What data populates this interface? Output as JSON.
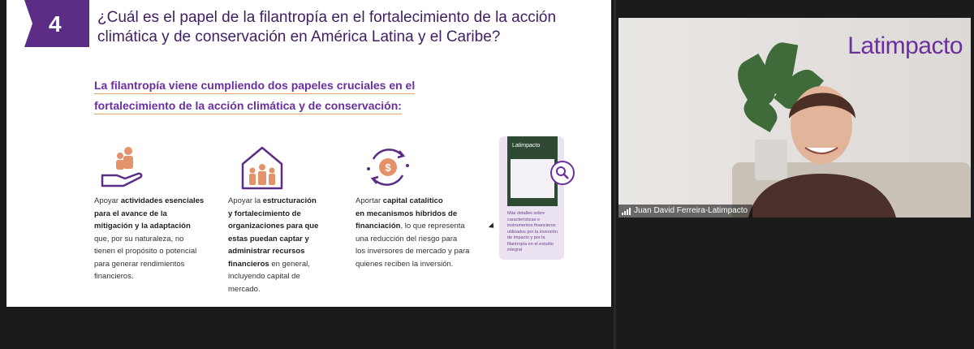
{
  "slide": {
    "number": "4",
    "title_line1": "¿Cuál es el papel de la filantropía en el fortalecimiento de la acción",
    "title_line2": "climática y de conservación en América Latina y el Caribe?",
    "subtitle_line1": "La filantropía viene cumpliendo dos papeles cruciales en el",
    "subtitle_line2": "fortalecimiento de la acción climática y de conservación:",
    "columns": [
      {
        "icon": "hand-people-icon",
        "lines": [
          {
            "pre": "Apoyar ",
            "bold": "actividades esenciales",
            "post": ""
          },
          {
            "pre": "",
            "bold": "para el avance de la",
            "post": ""
          },
          {
            "pre": "",
            "bold": "mitigación y la adaptación",
            "post": ""
          },
          {
            "pre": "que, por su naturaleza, no",
            "bold": "",
            "post": ""
          },
          {
            "pre": "tienen el propósito o potencial",
            "bold": "",
            "post": ""
          },
          {
            "pre": "para generar rendimientos",
            "bold": "",
            "post": ""
          },
          {
            "pre": "financieros.",
            "bold": "",
            "post": ""
          }
        ]
      },
      {
        "icon": "house-people-icon",
        "lines": [
          {
            "pre": "Apoyar la ",
            "bold": "estructuración",
            "post": ""
          },
          {
            "pre": "",
            "bold": "y fortalecimiento de",
            "post": ""
          },
          {
            "pre": "",
            "bold": "organizaciones para que",
            "post": ""
          },
          {
            "pre": "",
            "bold": "estas puedan captar y",
            "post": ""
          },
          {
            "pre": "",
            "bold": "administrar recursos",
            "post": ""
          },
          {
            "pre": "",
            "bold": "financieros",
            "post": " en general,"
          },
          {
            "pre": "incluyendo capital de",
            "bold": "",
            "post": ""
          },
          {
            "pre": "mercado.",
            "bold": "",
            "post": ""
          }
        ]
      },
      {
        "icon": "money-cycle-icon",
        "lines": [
          {
            "pre": "Aportar ",
            "bold": "capital catalítico",
            "post": ""
          },
          {
            "pre": "",
            "bold": "en mecanismos híbridos de",
            "post": ""
          },
          {
            "pre": "",
            "bold": "financiación",
            "post": ", lo que representa"
          },
          {
            "pre": "una reducción del riesgo para",
            "bold": "",
            "post": ""
          },
          {
            "pre": "los inversores de mercado y para",
            "bold": "",
            "post": ""
          },
          {
            "pre": "quienes reciben la inversión.",
            "bold": "",
            "post": ""
          }
        ]
      }
    ],
    "report": {
      "cover_logo": "Latimpacto",
      "text": "Más detalles sobre características e instrumentos financieros utilizados por la inversión de impacto y por la filantropía en el estudio integral"
    }
  },
  "video": {
    "brand": "Latimpacto",
    "participant_name": "Juan David Ferreira-Latimpacto"
  },
  "colors": {
    "accent": "#6b2fa0",
    "tab": "#5b2d86",
    "underline": "#e3a46b",
    "icon_orange": "#e3926a"
  }
}
